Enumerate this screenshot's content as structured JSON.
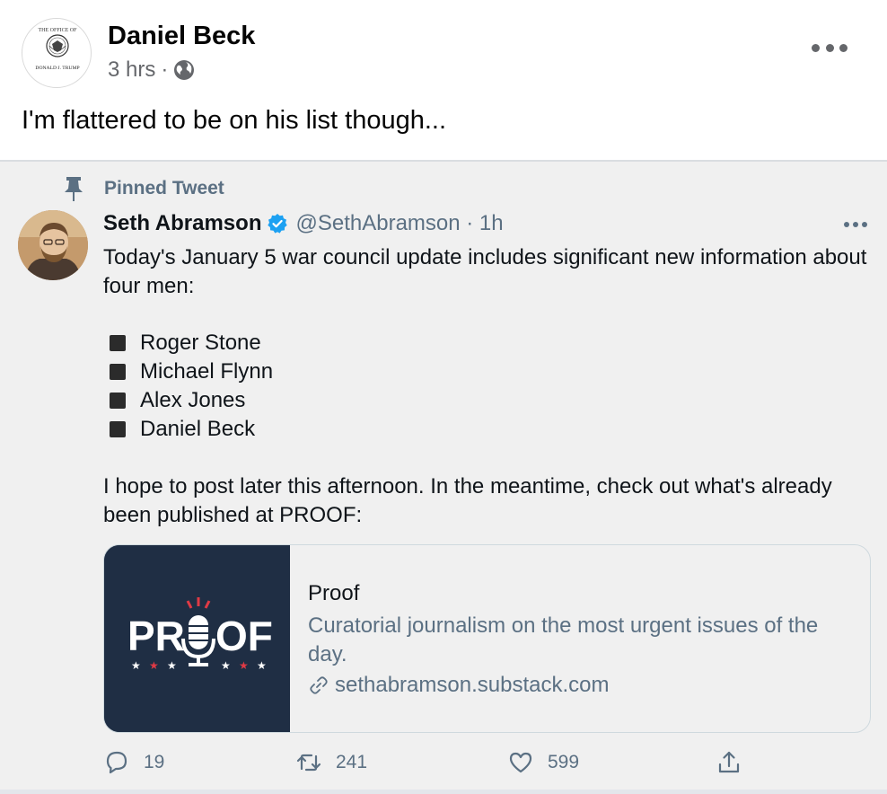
{
  "post": {
    "author": "Daniel Beck",
    "timestamp": "3 hrs",
    "separator": "·",
    "privacy_icon": "globe-icon",
    "text": "I'm flattered to be on his list though...",
    "avatar_seal_top": "THE OFFICE OF",
    "avatar_seal_bottom": "DONALD J. TRUMP"
  },
  "tweet": {
    "pinned_label": "Pinned Tweet",
    "name": "Seth Abramson",
    "handle": "@SethAbramson · 1h",
    "body_intro": "Today's January 5 war council update includes significant new information about four men:",
    "list": [
      "Roger Stone",
      "Michael Flynn",
      "Alex Jones",
      "Daniel Beck"
    ],
    "body_outro": "I hope to post later this afternoon. In the meantime, check out what's already been published at PROOF:",
    "card": {
      "logo_left": "PR",
      "logo_right": "OF",
      "title": "Proof",
      "description": "Curatorial journalism on the most urgent issues of the day.",
      "url": "sethabramson.substack.com"
    },
    "actions": {
      "replies": "19",
      "retweets": "241",
      "likes": "599"
    }
  },
  "colors": {
    "fb_secondary": "#65676b",
    "twitter_secondary": "#5b7083",
    "verified_blue": "#1da1f2",
    "proof_navy": "#1f2e44",
    "proof_red": "#e03a45"
  }
}
